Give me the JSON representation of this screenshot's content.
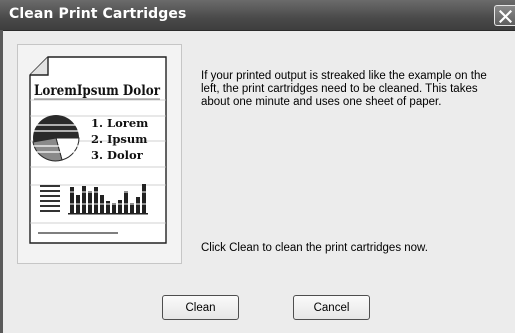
{
  "window": {
    "title": "Clean Print Cartridges",
    "close_icon": "close-icon"
  },
  "illustration": {
    "heading": "LoremIpsum Dolor",
    "list": [
      "1. Lorem",
      "2. Ipsum",
      "3. Dolor"
    ],
    "icons": [
      "pie-chart-icon",
      "bar-chart-icon"
    ]
  },
  "main": {
    "description": "If your printed output is streaked like the example on the left, the print cartridges need to be cleaned.  This takes about one minute and uses one sheet of paper.",
    "instruction": "Click Clean to clean the print cartridges now."
  },
  "buttons": {
    "clean_label": "Clean",
    "cancel_label": "Cancel"
  }
}
